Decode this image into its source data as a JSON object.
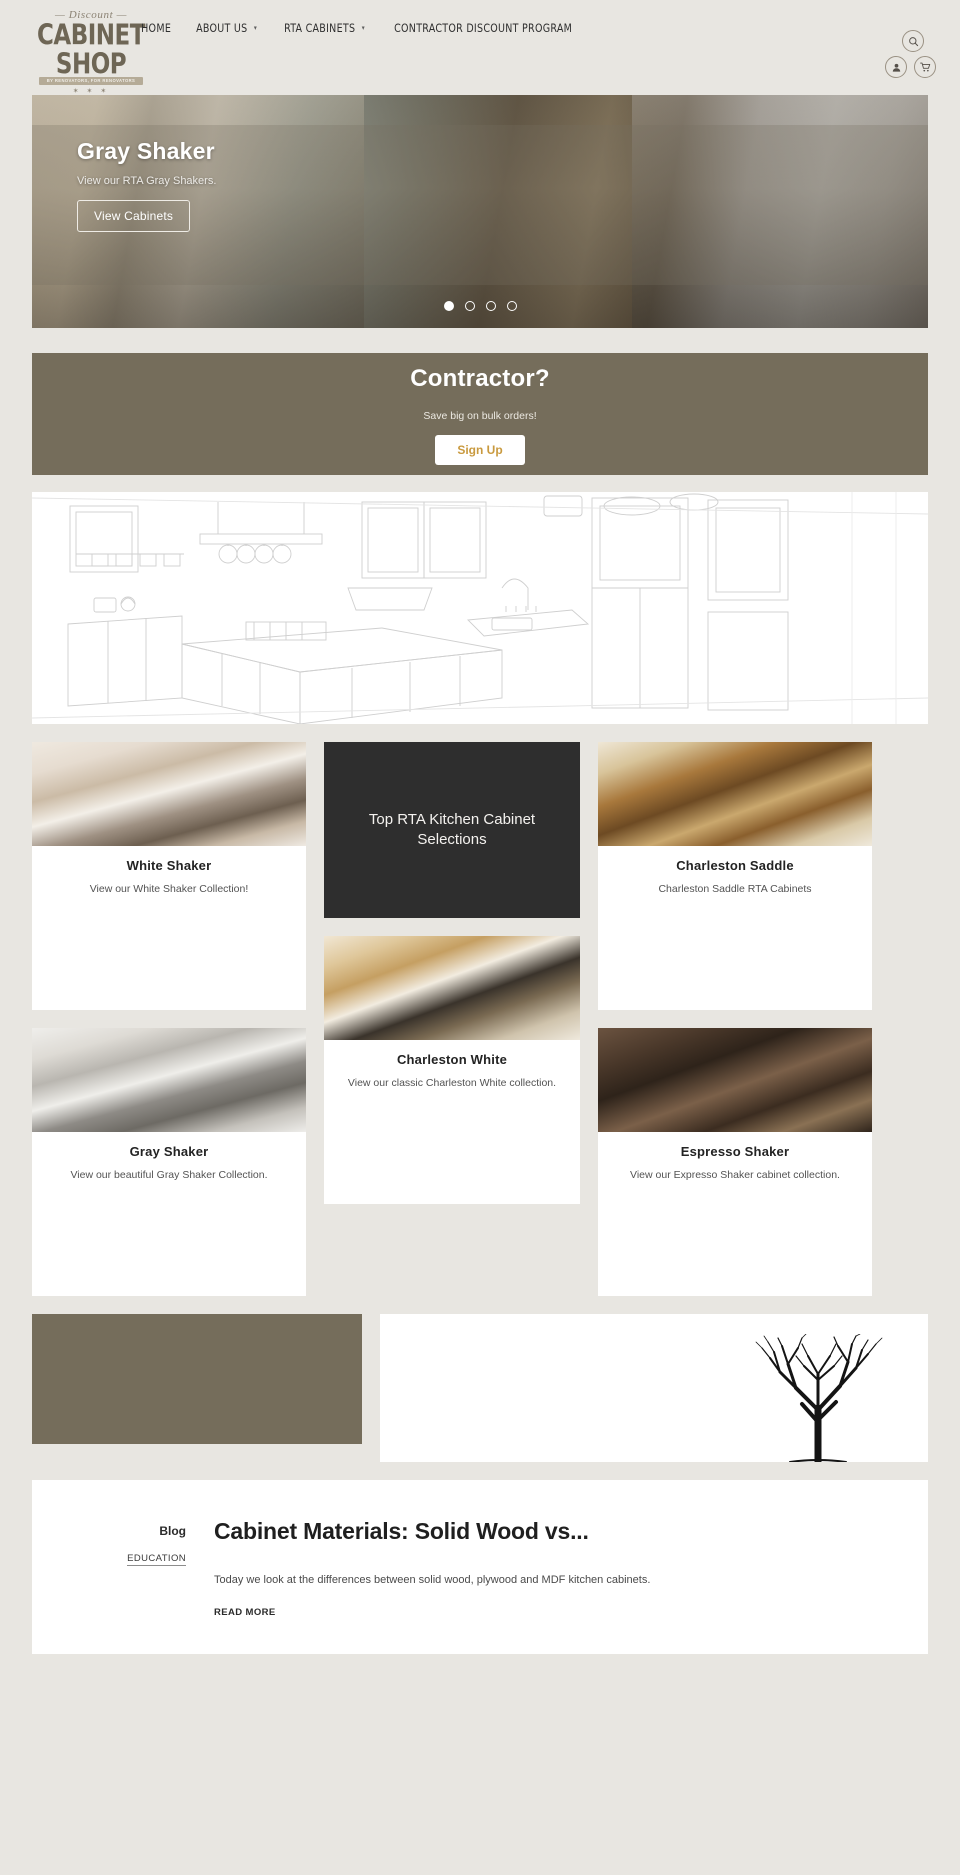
{
  "brand": {
    "logo_top": "— Discount —",
    "logo_main": "CABINET SHOP",
    "logo_ribbon": "BY RENOVATORS, FOR RENOVATORS",
    "logo_stars": "✶ ✶ ✶",
    "accent_brown": "#756d5b",
    "accent_gold": "#c99a3f",
    "page_bg": "#e8e6e1"
  },
  "nav": {
    "items": [
      {
        "label": "HOME",
        "has_dropdown": false
      },
      {
        "label": "ABOUT US",
        "has_dropdown": true
      },
      {
        "label": "RTA CABINETS",
        "has_dropdown": true
      },
      {
        "label": "CONTRACTOR DISCOUNT PROGRAM",
        "has_dropdown": false
      }
    ],
    "caret": "▾"
  },
  "header_actions": {
    "search": "search-icon",
    "account": "account-icon",
    "cart": "cart-icon"
  },
  "hero": {
    "title": "Gray Shaker",
    "subtitle": "View our RTA Gray Shakers.",
    "cta": "View Cabinets",
    "slides": 4,
    "active_slide": 1
  },
  "contractor": {
    "heading": "Contractor?",
    "subtext": "Save big on bulk orders!",
    "cta": "Sign Up"
  },
  "cards": {
    "white_shaker": {
      "title": "White Shaker",
      "desc": "View our White Shaker Collection!"
    },
    "charleston_saddle": {
      "title": "Charleston Saddle",
      "desc": "Charleston Saddle RTA Cabinets"
    },
    "feature": {
      "title": "Top RTA Kitchen Cabinet Selections"
    },
    "gray_shaker": {
      "title": "Gray Shaker",
      "desc": "View our beautiful Gray Shaker Collection."
    },
    "charleston_white": {
      "title": "Charleston White",
      "desc": "View our classic Charleston White collection."
    },
    "espresso_shaker": {
      "title": "Espresso Shaker",
      "desc": "View our Expresso Shaker cabinet collection."
    }
  },
  "blog": {
    "kicker": "Blog",
    "category": "EDUCATION",
    "title": "Cabinet Materials: Solid Wood vs...",
    "excerpt": "Today we look at the differences between solid wood, plywood and MDF kitchen cabinets.",
    "read_more": "READ MORE"
  }
}
